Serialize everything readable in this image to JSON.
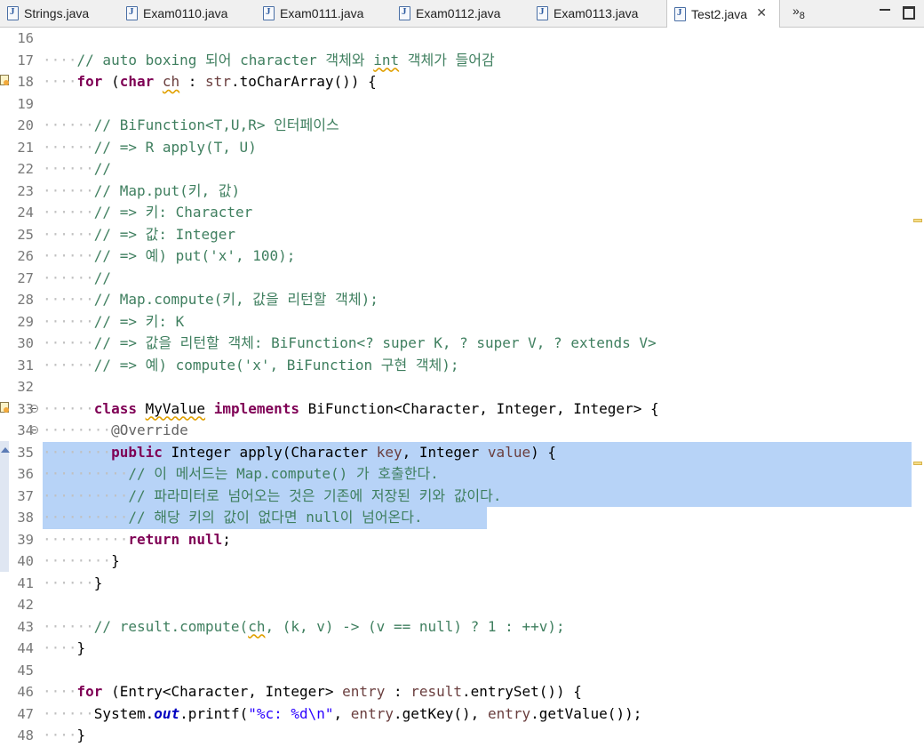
{
  "tabs": [
    {
      "label": "Strings.java",
      "active": false
    },
    {
      "label": "Exam0110.java",
      "active": false
    },
    {
      "label": "Exam0111.java",
      "active": false
    },
    {
      "label": "Exam0112.java",
      "active": false
    },
    {
      "label": "Exam0113.java",
      "active": false
    },
    {
      "label": "Test2.java",
      "active": true
    }
  ],
  "tab_close": "✕",
  "overflow": {
    "glyph": "»",
    "count": "8"
  },
  "colors": {
    "keyword": "#7f0055",
    "comment": "#3f7f5f",
    "local_variable": "#6a3e3e",
    "string": "#2a00ff",
    "selection": "#b7d3f7",
    "line_number": "#787878"
  },
  "code_lines": [
    {
      "n": "16",
      "html": ""
    },
    {
      "n": "17",
      "html": "<span class='dots'>····</span><span class='cm'>// auto boxing 되어 character 객체와 <span class='warn'>int</span> 객체가 들어감</span>"
    },
    {
      "n": "18",
      "marker": "warning",
      "html": "<span class='dots'>····</span><span class='kw'>for</span> (<span class='kw'>char</span> <span class='var warn'>ch</span> : <span class='var'>str</span>.toCharArray()) {"
    },
    {
      "n": "19",
      "html": ""
    },
    {
      "n": "20",
      "html": "<span class='dots'>······</span><span class='cm'>// BiFunction&lt;T,U,R&gt; 인터페이스</span>"
    },
    {
      "n": "21",
      "html": "<span class='dots'>······</span><span class='cm'>// =&gt; R apply(T, U)</span>"
    },
    {
      "n": "22",
      "html": "<span class='dots'>······</span><span class='cm'>//</span>"
    },
    {
      "n": "23",
      "html": "<span class='dots'>······</span><span class='cm'>// Map.put(키, 값)</span>"
    },
    {
      "n": "24",
      "html": "<span class='dots'>······</span><span class='cm'>// =&gt; 키: Character</span>"
    },
    {
      "n": "25",
      "html": "<span class='dots'>······</span><span class='cm'>// =&gt; 값: Integer</span>"
    },
    {
      "n": "26",
      "html": "<span class='dots'>······</span><span class='cm'>// =&gt; 예) put('x', 100);</span>"
    },
    {
      "n": "27",
      "html": "<span class='dots'>······</span><span class='cm'>//</span>"
    },
    {
      "n": "28",
      "html": "<span class='dots'>······</span><span class='cm'>// Map.compute(키, 값을 리턴할 객체);</span>"
    },
    {
      "n": "29",
      "html": "<span class='dots'>······</span><span class='cm'>// =&gt; 키: K</span>"
    },
    {
      "n": "30",
      "html": "<span class='dots'>······</span><span class='cm'>// =&gt; 값을 리턴할 객체: BiFunction&lt;? super K, ? super V, ? extends V&gt;</span>"
    },
    {
      "n": "31",
      "html": "<span class='dots'>······</span><span class='cm'>// =&gt; 예) compute('x', BiFunction 구현 객체);</span>"
    },
    {
      "n": "32",
      "html": ""
    },
    {
      "n": "33",
      "marker": "warning",
      "fold": true,
      "html": "<span class='dots'>······</span><span class='kw'>class</span> <span class='warn'>MyValue</span> <span class='kw'>implements</span> BiFunction&lt;Character, Integer, Integer&gt; {"
    },
    {
      "n": "34",
      "fold": true,
      "html": "<span class='dots'>········</span><span class='ann'>@Override</span>"
    },
    {
      "n": "35",
      "marker": "override",
      "highlight": "full",
      "html": "<span class='dots'>········</span><span class='kw'>public</span> Integer apply(Character <span class='var'>key</span>, Integer <span class='var'>value</span>) {"
    },
    {
      "n": "36",
      "highlight": "full",
      "html": "<span class='dots'>··········</span><span class='cm'>// 이 메서드는 Map.compute() 가 호출한다.</span>"
    },
    {
      "n": "37",
      "highlight": "full",
      "html": "<span class='dots'>··········</span><span class='cm'>// 파라미터로 넘어오는 것은 기존에 저장된 키와 값이다.</span>"
    },
    {
      "n": "38",
      "highlight": "partial",
      "html": "<span class='dots'>··········</span><span class='cm'>// 해당 키의 값이 없다면 null이 넘어온다.</span>"
    },
    {
      "n": "39",
      "html": "<span class='dots'>··········</span><span class='kw'>return</span> <span class='kw'>null</span>;"
    },
    {
      "n": "40",
      "html": "<span class='dots'>········</span>}"
    },
    {
      "n": "41",
      "html": "<span class='dots'>······</span>}"
    },
    {
      "n": "42",
      "html": ""
    },
    {
      "n": "43",
      "html": "<span class='dots'>······</span><span class='cm'>// result.compute(<span class='warn'>ch</span>, (k, v) -&gt; (v == null) ? 1 : ++v);</span>"
    },
    {
      "n": "44",
      "html": "<span class='dots'>····</span>}"
    },
    {
      "n": "45",
      "html": ""
    },
    {
      "n": "46",
      "html": "<span class='dots'>····</span><span class='kw'>for</span> (Entry&lt;Character, Integer&gt; <span class='var'>entry</span> : <span class='var'>result</span>.entrySet()) {"
    },
    {
      "n": "47",
      "html": "<span class='dots'>······</span>System.<span class='fld'>out</span>.printf(<span class='str'>\"%c: %d\\n\"</span>, <span class='var'>entry</span>.getKey(), <span class='var'>entry</span>.getValue());"
    },
    {
      "n": "48",
      "html": "<span class='dots'>····</span>}"
    }
  ]
}
